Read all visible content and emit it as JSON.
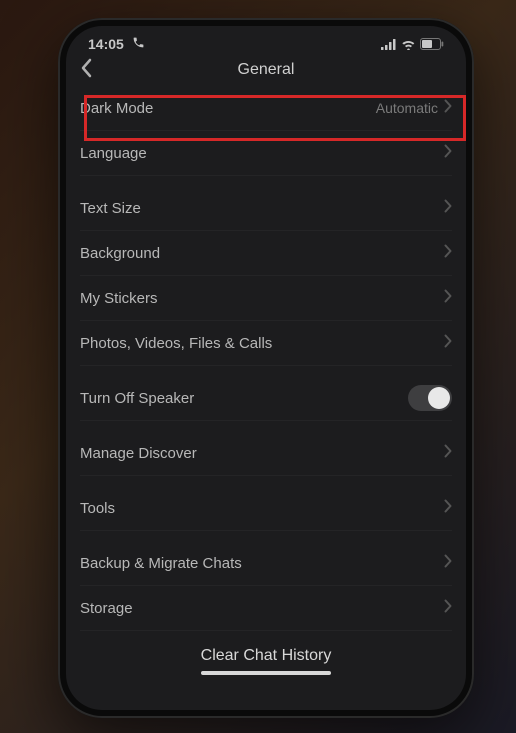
{
  "status": {
    "time": "14:05",
    "callIcon": "call-icon"
  },
  "nav": {
    "title": "General"
  },
  "rows": [
    {
      "label": "Dark Mode",
      "value": "Automatic",
      "chev": true,
      "highlight": true
    },
    {
      "label": "Language",
      "chev": true
    },
    {
      "label": "Text Size",
      "chev": true,
      "sep": true
    },
    {
      "label": "Background",
      "chev": true
    },
    {
      "label": "My Stickers",
      "chev": true
    },
    {
      "label": "Photos, Videos, Files & Calls",
      "chev": true
    },
    {
      "label": "Turn Off Speaker",
      "toggle": true,
      "sep": true
    },
    {
      "label": "Manage Discover",
      "chev": true,
      "sep": true
    },
    {
      "label": "Tools",
      "chev": true,
      "sep": true
    },
    {
      "label": "Backup & Migrate Chats",
      "chev": true,
      "sep": true
    },
    {
      "label": "Storage",
      "chev": true
    }
  ],
  "footer": {
    "clear": "Clear Chat History"
  }
}
